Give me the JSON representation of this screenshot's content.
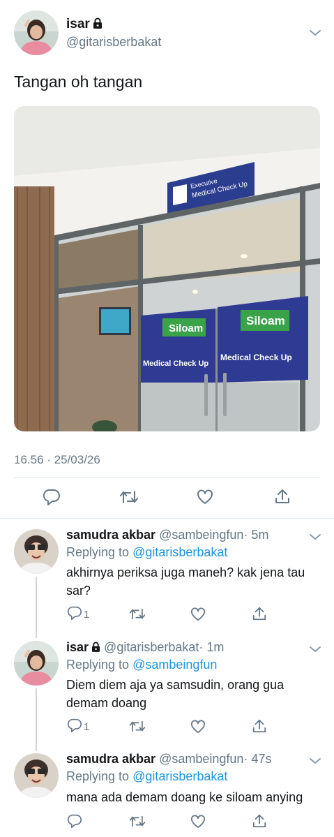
{
  "main_tweet": {
    "author_name": "isar",
    "author_handle": "@gitarisberbakat",
    "text": "Tangan oh tangan",
    "timestamp": "16.56 · 25/03/26",
    "photo": {
      "sign_text_line1": "Executive",
      "sign_text_line2": "Medical Check Up",
      "door_logo": "Siloam",
      "door_caption": "Medical Check Up"
    }
  },
  "replies": [
    {
      "author_name": "samudra akbar",
      "author_handle": "@sambeingfun",
      "time": "· 5m",
      "replying_label": "Replying to",
      "replying_to": "@gitarisberbakat",
      "text": "akhirnya periksa juga maneh? kak jena tau sar?",
      "reply_count": "1"
    },
    {
      "author_name": "isar",
      "author_handle": "@gitarisberbakat",
      "time": "· 1m",
      "replying_label": "Replying to",
      "replying_to": "@sambeingfun",
      "text": "Diem diem aja ya samsudin, orang gua demam doang",
      "reply_count": "1"
    },
    {
      "author_name": "samudra akbar",
      "author_handle": "@sambeingfun",
      "time": "· 47s",
      "replying_label": "Replying to",
      "replying_to": "@gitarisberbakat",
      "text": "mana ada demam doang ke siloam anying",
      "reply_count": ""
    }
  ],
  "colors": {
    "link": "#1b95e0",
    "secondary_text": "#657786",
    "divider": "#e1e8ed",
    "icon": "#657786"
  },
  "icons": [
    "lock-icon",
    "chevron-down-icon",
    "reply-icon",
    "retweet-icon",
    "like-icon",
    "share-icon"
  ]
}
